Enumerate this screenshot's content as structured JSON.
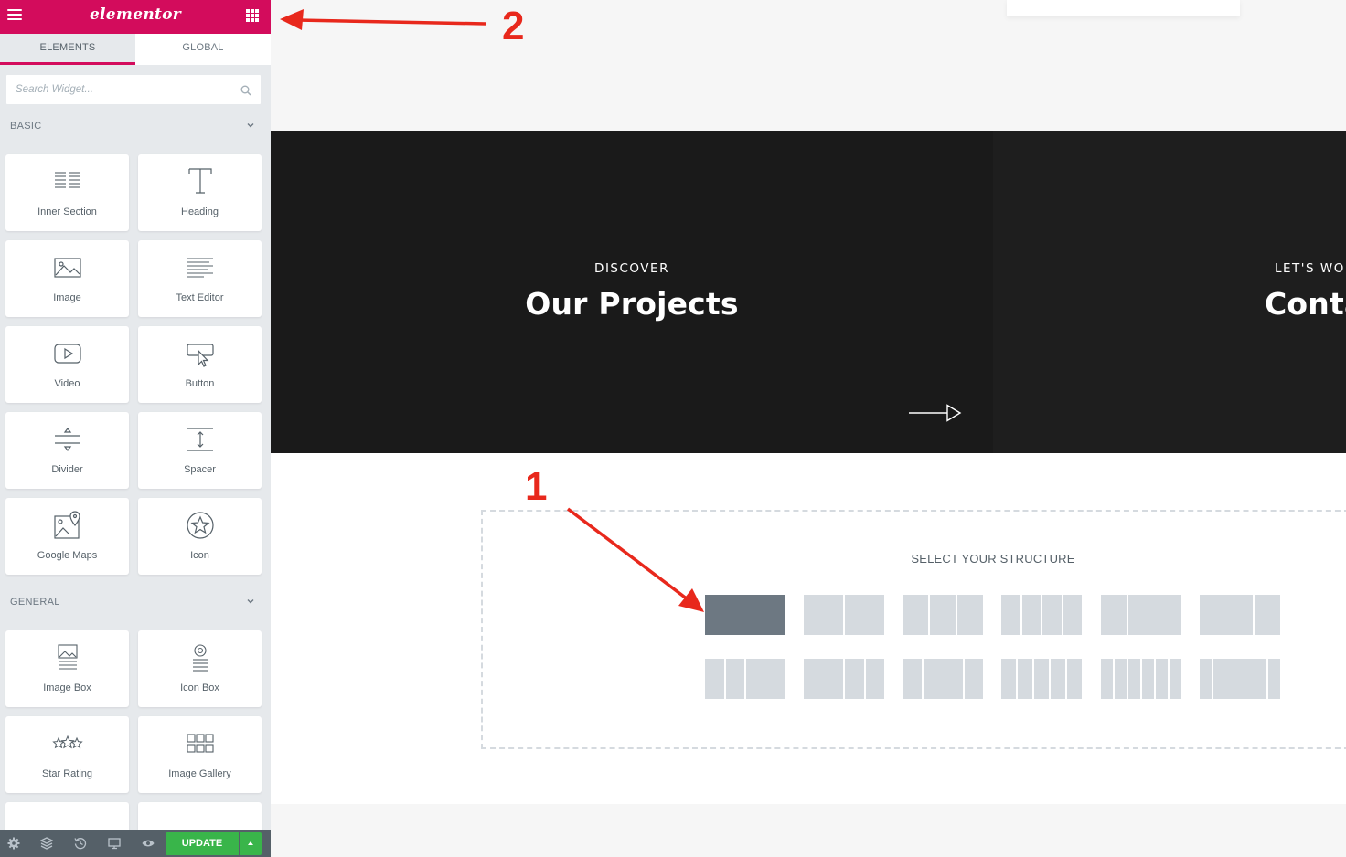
{
  "panel": {
    "logo_text": "elementor",
    "tabs": [
      {
        "label": "ELEMENTS",
        "active": true
      },
      {
        "label": "GLOBAL",
        "active": false
      }
    ],
    "search": {
      "placeholder": "Search Widget..."
    },
    "categories": [
      {
        "title": "BASIC",
        "widgets": [
          "Inner Section",
          "Heading",
          "Image",
          "Text Editor",
          "Video",
          "Button",
          "Divider",
          "Spacer",
          "Google Maps",
          "Icon"
        ]
      },
      {
        "title": "GENERAL",
        "widgets": [
          "Image Box",
          "Icon Box",
          "Star Rating",
          "Image Gallery"
        ]
      }
    ],
    "footer": {
      "update_label": "UPDATE"
    }
  },
  "canvas": {
    "column_left": {
      "kicker": "DISCOVER",
      "title": "Our Projects"
    },
    "column_right": {
      "kicker": "LET'S WOR",
      "title": "Conta"
    },
    "structure": {
      "title": "SELECT YOUR STRUCTURE",
      "selected_index": 0,
      "preset_count": 12
    }
  },
  "annotations": [
    "2",
    "1"
  ],
  "colors": {
    "brand": "#d30c5c",
    "update_button": "#39b54a",
    "annotation": "#e8281c",
    "dark_section": "#1a1a1a"
  }
}
